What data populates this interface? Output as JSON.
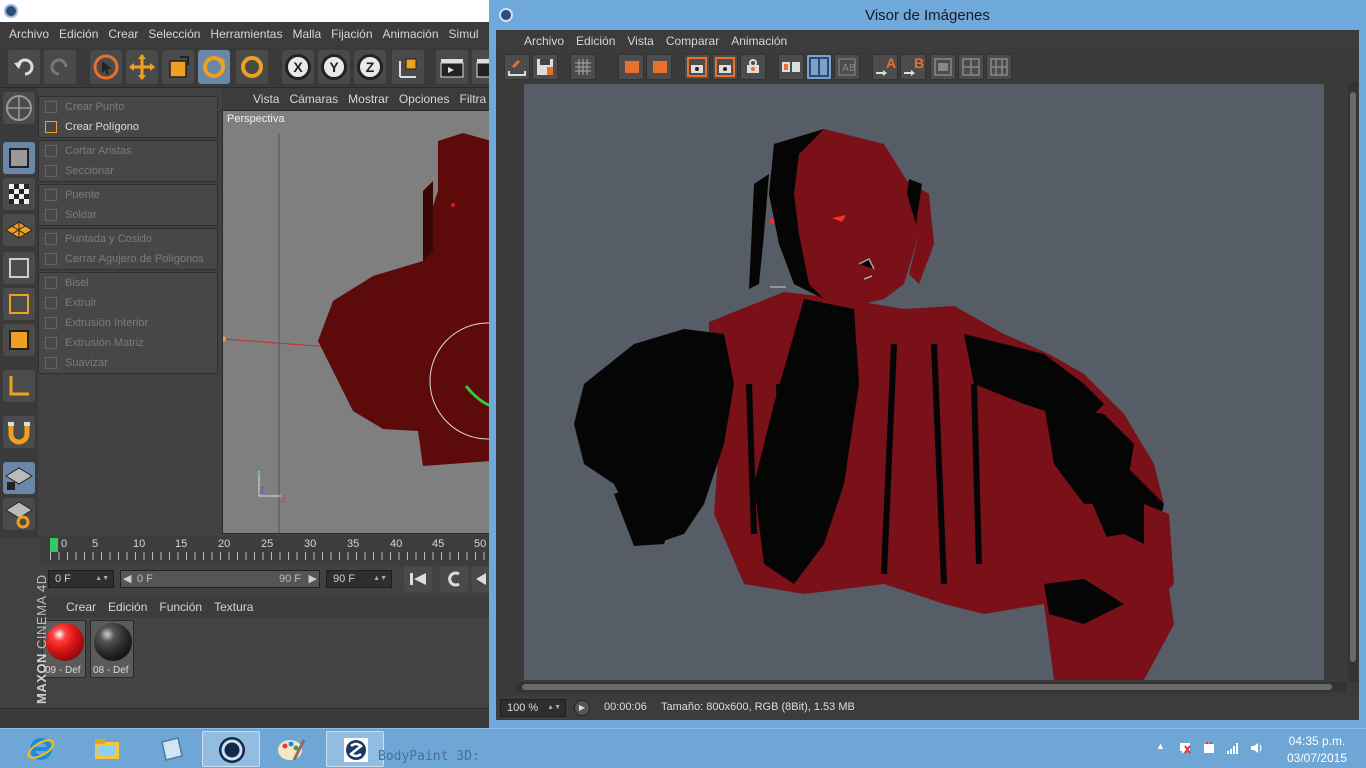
{
  "c4d": {
    "menu": [
      "Archivo",
      "Edición",
      "Crear",
      "Selección",
      "Herramientas",
      "Malla",
      "Fijación",
      "Animación",
      "Simul"
    ],
    "palette_groups": [
      [
        {
          "label": "Crear Punto",
          "enabled": false
        },
        {
          "label": "Crear Polígono",
          "enabled": true
        }
      ],
      [
        {
          "label": "Cortar Aristas",
          "enabled": false
        },
        {
          "label": "Seccionar",
          "enabled": false
        }
      ],
      [
        {
          "label": "Puente",
          "enabled": false
        },
        {
          "label": "Soldar",
          "enabled": false
        }
      ],
      [
        {
          "label": "Puntada y Cosido",
          "enabled": false
        },
        {
          "label": "Cerrar Agujero de Polígonos",
          "enabled": false
        }
      ],
      [
        {
          "label": "Bisel",
          "enabled": false
        },
        {
          "label": "Extruir",
          "enabled": false
        },
        {
          "label": "Extrusión Interior",
          "enabled": false
        },
        {
          "label": "Extrusión Matriz",
          "enabled": false
        },
        {
          "label": "Suavizar",
          "enabled": false
        }
      ]
    ],
    "viewport": {
      "menu": [
        "Vista",
        "Cámaras",
        "Mostrar",
        "Opciones",
        "Filtra"
      ],
      "label": "Perspectiva"
    },
    "timeline": {
      "ticks": [
        "0",
        "5",
        "10",
        "15",
        "20",
        "25",
        "30",
        "35",
        "40",
        "45",
        "50"
      ],
      "current_frame": "0 F",
      "slider_start": "0 F",
      "slider_end": "90 F",
      "end_frame": "90 F"
    },
    "materials": {
      "menu": [
        "Crear",
        "Edición",
        "Función",
        "Textura"
      ],
      "items": [
        {
          "name": "09 - Def",
          "color": "#d81414"
        },
        {
          "name": "08 - Def",
          "color": "#2a2a2a"
        }
      ]
    },
    "brand": {
      "maxon": "MAXON",
      "product": "CINEMA 4D"
    }
  },
  "viewer": {
    "title": "Visor de Imágenes",
    "menu": [
      "Archivo",
      "Edición",
      "Vista",
      "Comparar",
      "Animación"
    ],
    "toolbar_letters": {
      "a": "A",
      "b": "B"
    },
    "status": {
      "zoom": "100 %",
      "time": "00:00:06",
      "info": "Tamaño: 800x600, RGB (8Bit), 1.53 MB"
    },
    "render_colors": {
      "background": "#565d66",
      "primary": "#7a1018",
      "shadow": "#050505"
    }
  },
  "taskbar": {
    "items": [
      "ie-icon",
      "explorer-icon",
      "notepad-icon",
      "cinema4d-icon",
      "paint-icon",
      "bodypaint-icon"
    ],
    "ghost_text": "BodyPaint 3D:",
    "clock_time": "04:35 p.m.",
    "clock_date": "03/07/2015",
    "accent": "#6ea6d6"
  }
}
